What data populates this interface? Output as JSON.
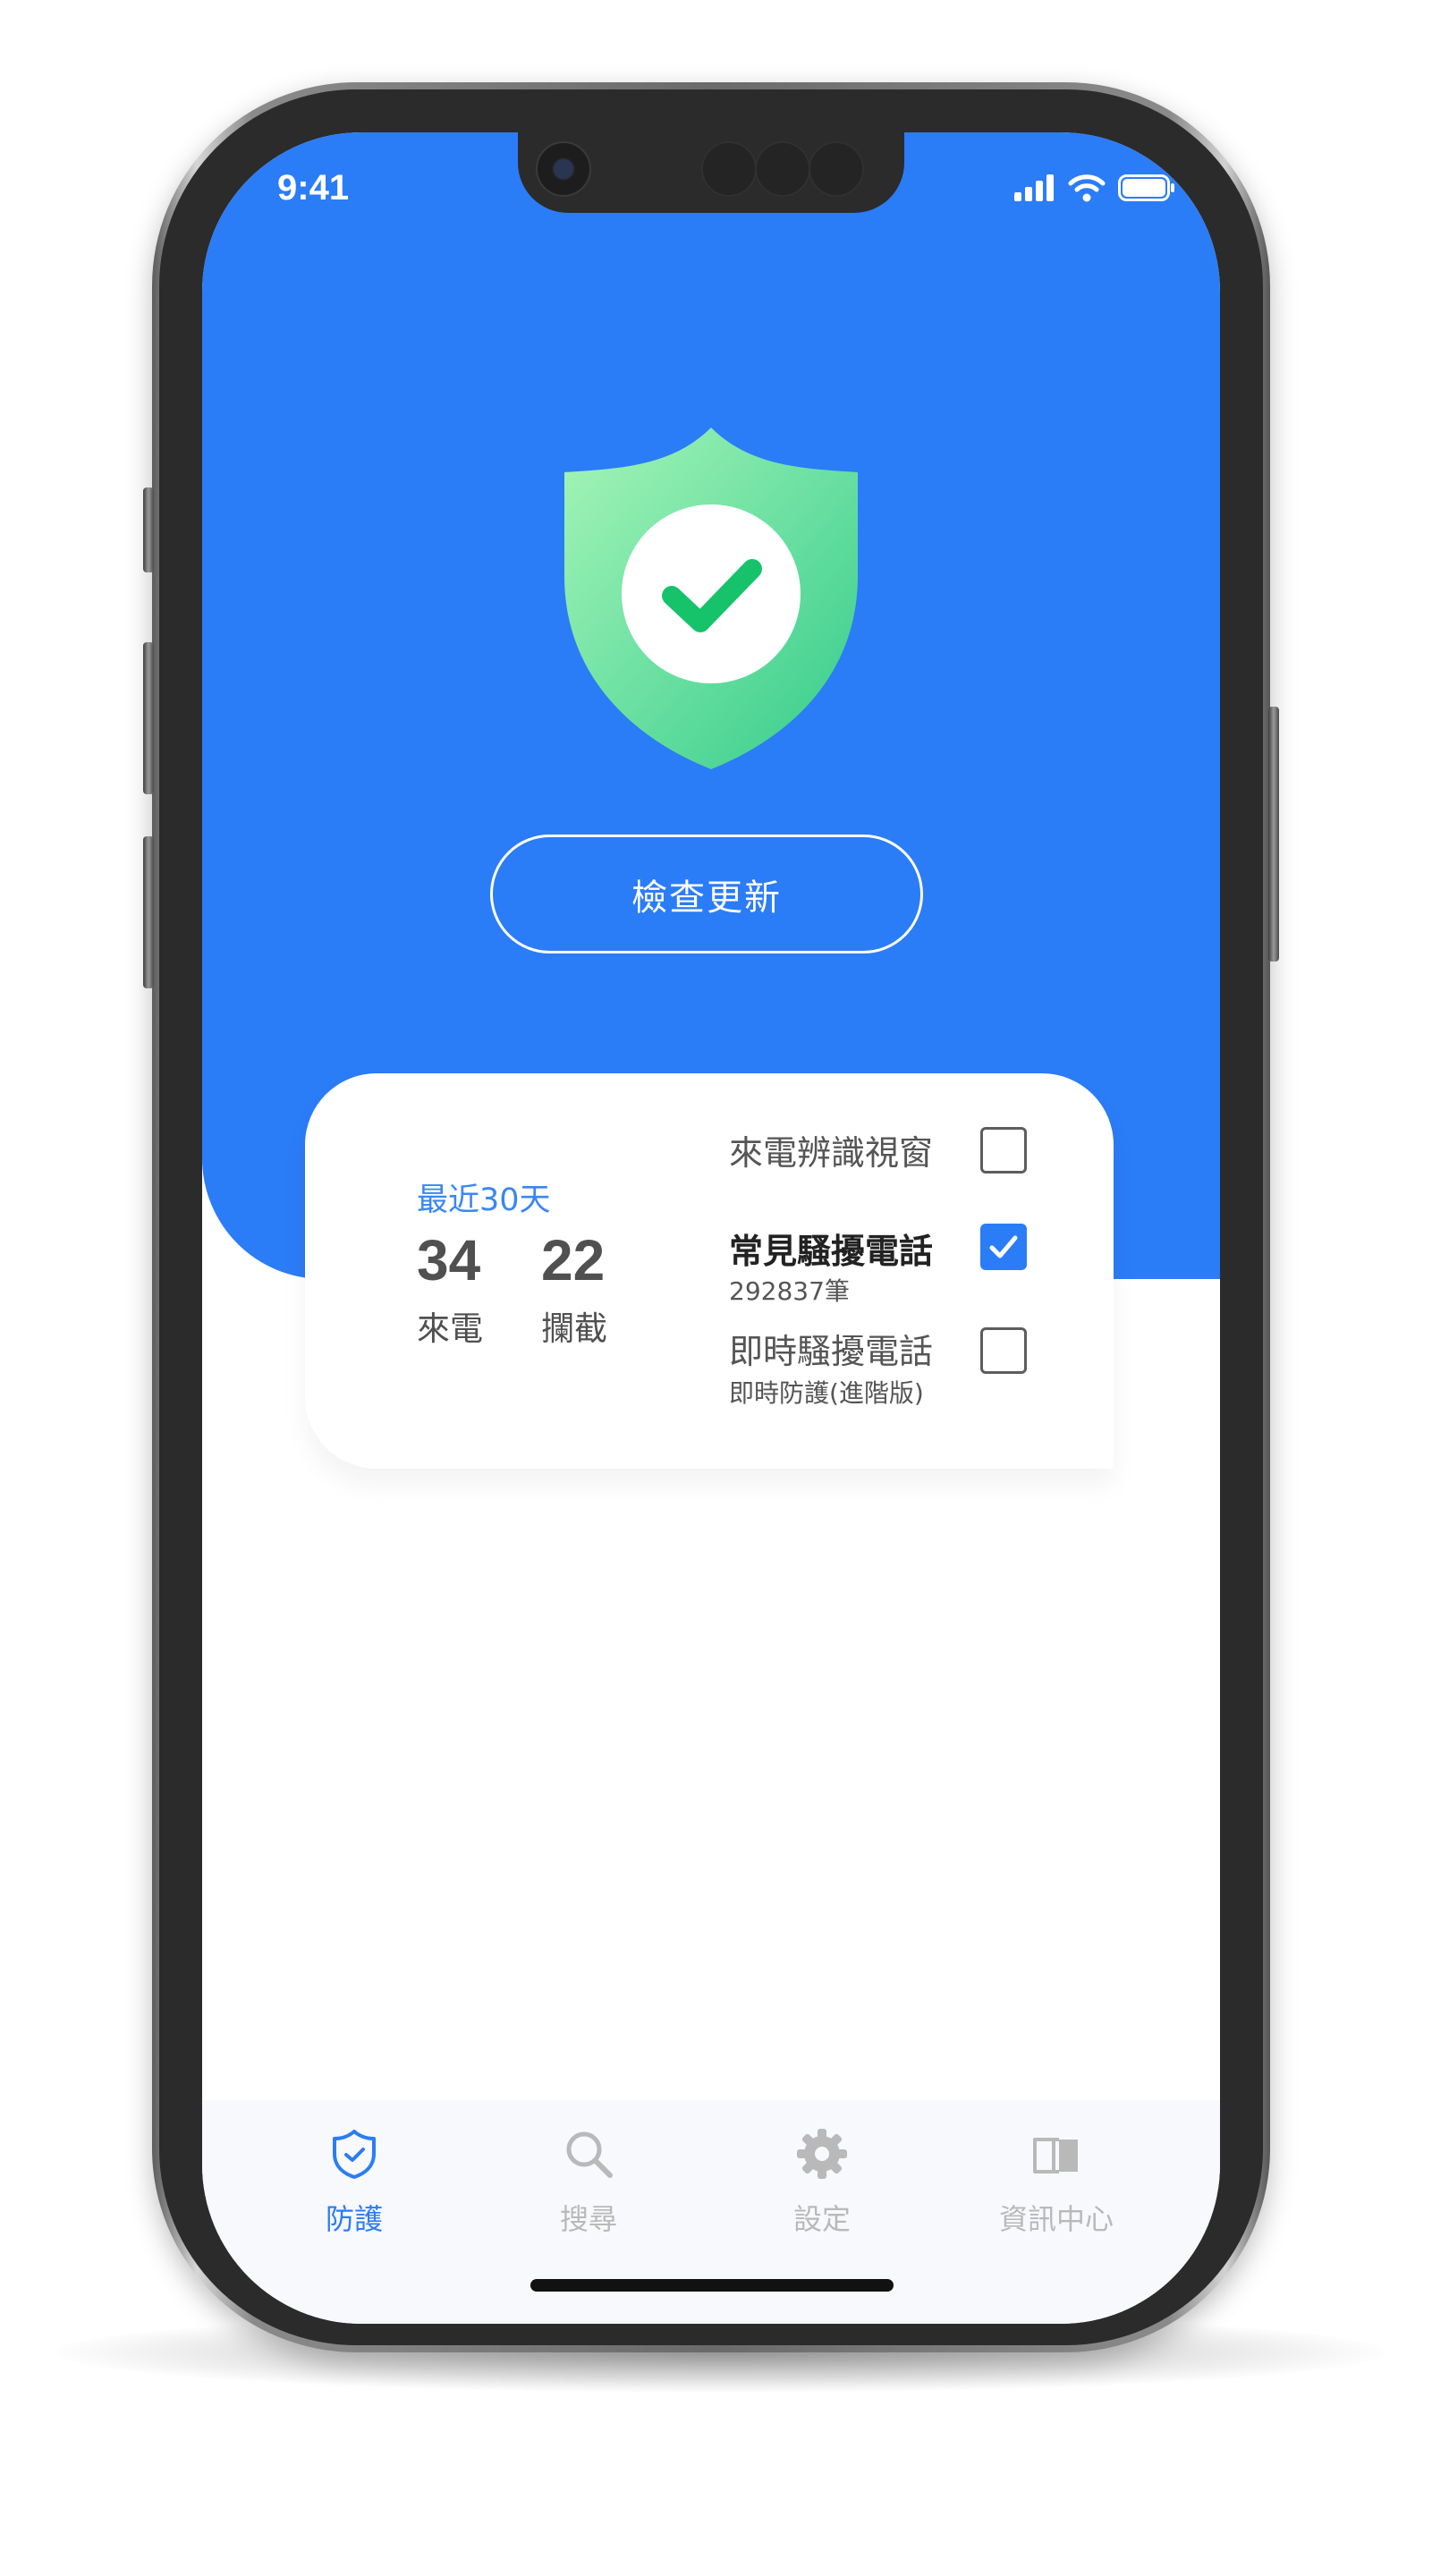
{
  "status_bar": {
    "time": "9:41"
  },
  "hero": {
    "update_button_label": "檢查更新"
  },
  "stats": {
    "period_label": "最近30天",
    "calls_value": "34",
    "calls_label": "來電",
    "blocked_value": "22",
    "blocked_label": "攔截"
  },
  "options": [
    {
      "label": "來電辨識視窗",
      "sublabel": "",
      "checked": false
    },
    {
      "label": "常見騷擾電話",
      "sublabel": "292837筆",
      "checked": true
    },
    {
      "label": "即時騷擾電話",
      "sublabel": "即時防護(進階版)",
      "checked": false
    }
  ],
  "tabs": [
    {
      "label": "防護",
      "icon": "shield-check-icon",
      "active": true
    },
    {
      "label": "搜尋",
      "icon": "search-icon",
      "active": false
    },
    {
      "label": "設定",
      "icon": "gear-icon",
      "active": false
    },
    {
      "label": "資訊中心",
      "icon": "book-icon",
      "active": false
    }
  ],
  "colors": {
    "primary": "#2b7cf7",
    "shield_gradient_start": "#9bf2b3",
    "shield_gradient_end": "#3fd18e",
    "check": "#16c36b",
    "tab_inactive": "#b9b9b9"
  }
}
